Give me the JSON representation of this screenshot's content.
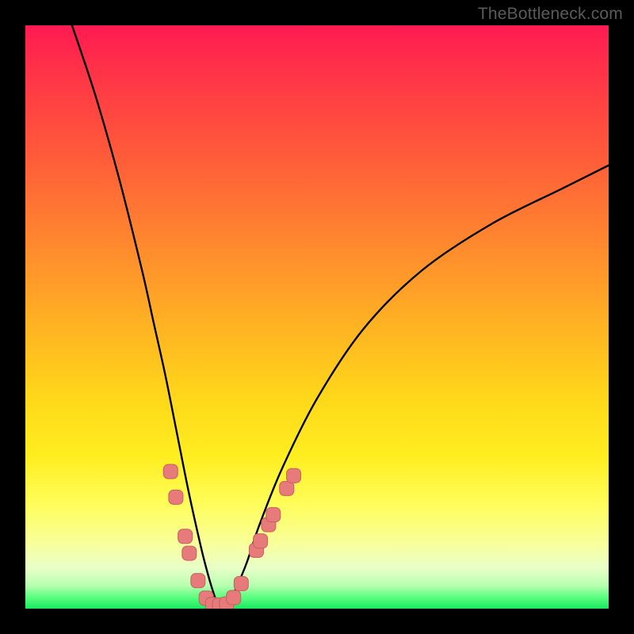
{
  "watermark": "TheBottleneck.com",
  "colors": {
    "frame": "#000000",
    "curve": "#000000",
    "marker_fill": "#e77a7a",
    "marker_stroke": "#c95f5f",
    "gradient_top": "#ff1a52",
    "gradient_bottom": "#18e860"
  },
  "chart_data": {
    "type": "line",
    "title": "",
    "xlabel": "",
    "ylabel": "",
    "xlim": [
      0,
      100
    ],
    "ylim": [
      0,
      100
    ],
    "note": "No numeric axis ticks or labels are rendered; coordinates below are in percent of plot width/height (0,0 at bottom-left). Curve is a V-shaped trough reaching ~0 near x≈33. Values approximate from pixel positions.",
    "series": [
      {
        "name": "curve",
        "x": [
          8,
          12,
          16,
          20,
          22,
          24,
          26,
          28,
          30,
          31,
          32,
          33,
          34,
          35,
          36,
          38,
          40,
          44,
          50,
          58,
          68,
          80,
          92,
          100
        ],
        "y": [
          100,
          88,
          74,
          58,
          49,
          40,
          30,
          20,
          11,
          7,
          3.5,
          0.8,
          0.6,
          1.4,
          3.2,
          8,
          14,
          24,
          36,
          48,
          58,
          66,
          72,
          76
        ]
      }
    ],
    "markers": {
      "name": "pink-rounded-markers",
      "shape": "rounded-rect",
      "approx_size_px": 18,
      "points": [
        {
          "x": 24.9,
          "y": 23.5
        },
        {
          "x": 25.8,
          "y": 19.1
        },
        {
          "x": 27.4,
          "y": 12.4
        },
        {
          "x": 28.1,
          "y": 9.5
        },
        {
          "x": 29.6,
          "y": 4.8
        },
        {
          "x": 31.0,
          "y": 1.8
        },
        {
          "x": 32.1,
          "y": 0.7
        },
        {
          "x": 33.3,
          "y": 0.6
        },
        {
          "x": 34.5,
          "y": 0.8
        },
        {
          "x": 35.7,
          "y": 1.9
        },
        {
          "x": 37.0,
          "y": 4.3
        },
        {
          "x": 39.6,
          "y": 10.0
        },
        {
          "x": 40.3,
          "y": 11.6
        },
        {
          "x": 41.7,
          "y": 14.4
        },
        {
          "x": 42.5,
          "y": 16.1
        },
        {
          "x": 44.8,
          "y": 20.6
        },
        {
          "x": 46.0,
          "y": 22.8
        }
      ]
    }
  }
}
